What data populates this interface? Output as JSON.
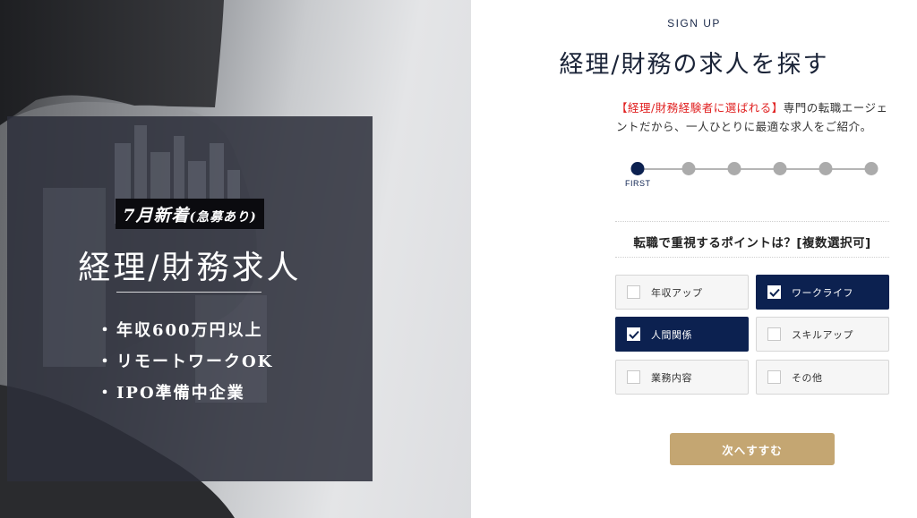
{
  "hero": {
    "tag_main": "7月新着",
    "tag_sub": "(急募あり)",
    "title": "経理/財務求人",
    "bullets": [
      "年収600万円以上",
      "リモートワークOK",
      "IPO準備中企業"
    ]
  },
  "form": {
    "eyebrow": "SIGN UP",
    "title": "経理/財務の求人を探す",
    "intro_highlight": "【経理/財務経験者に選ばれる】",
    "intro_rest": "専門の転職エージェントだから、一人ひとりに最適な求人をご紹介。",
    "stepper": {
      "total_steps": 6,
      "current_step": 1,
      "current_label": "FIRST"
    },
    "question": "転職で重視するポイントは？[複数選択可]",
    "options": [
      {
        "label": "年収アップ",
        "checked": false
      },
      {
        "label": "ワークライフ",
        "checked": true
      },
      {
        "label": "人間関係",
        "checked": true
      },
      {
        "label": "スキルアップ",
        "checked": false
      },
      {
        "label": "業務内容",
        "checked": false
      },
      {
        "label": "その他",
        "checked": false
      }
    ],
    "next_label": "次へすすむ"
  },
  "colors": {
    "navy": "#0c2150",
    "gold": "#c4a672",
    "highlight_red": "#e02020"
  }
}
